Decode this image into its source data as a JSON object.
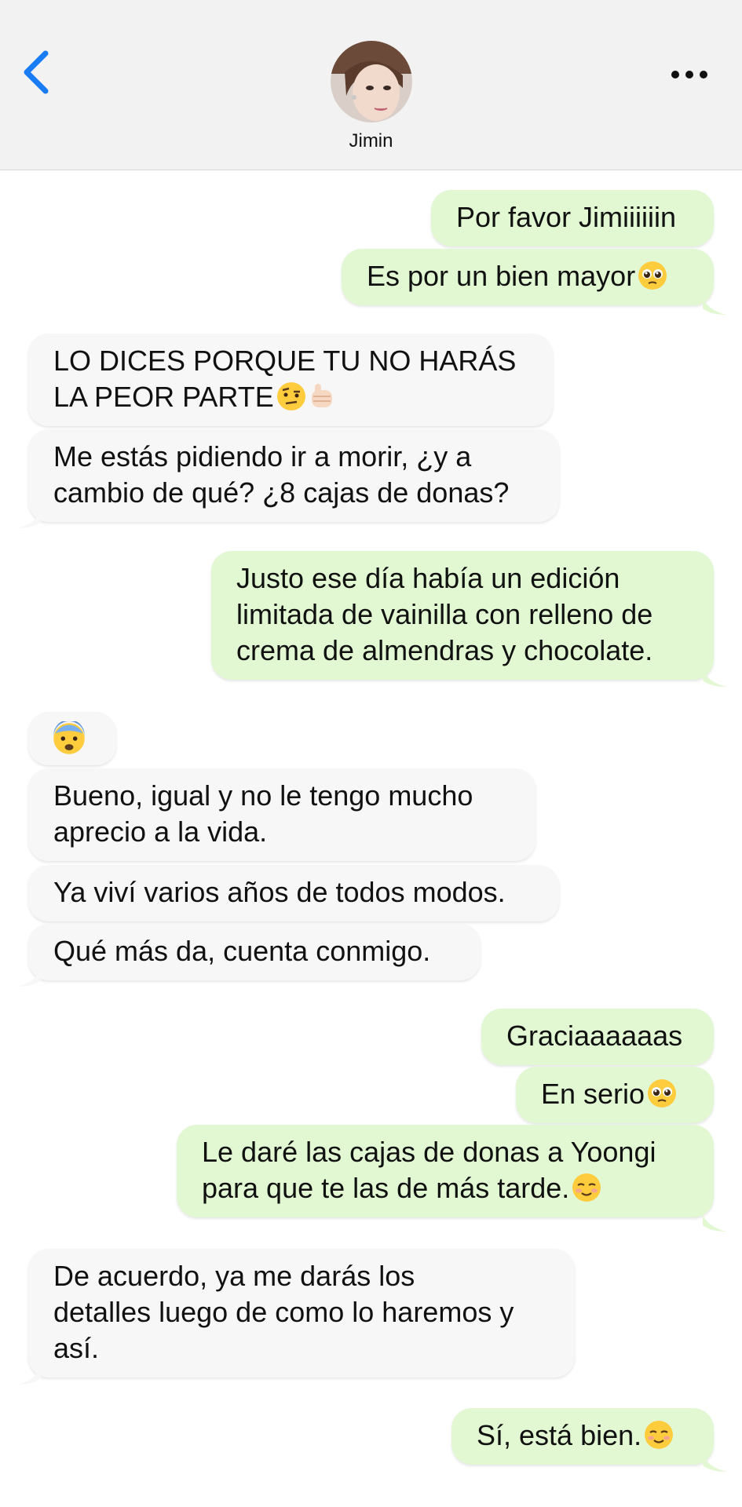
{
  "header": {
    "back_icon": "chevron-left-icon",
    "contact_name": "Jimin",
    "more_icon": "ellipsis-icon"
  },
  "colors": {
    "accent": "#1a7cf5",
    "outgoing_bubble": "#e2f8d3",
    "incoming_bubble": "#f7f7f7",
    "header_bg": "#f2f2f2"
  },
  "messages": [
    {
      "dir": "out",
      "lines": [
        "Por favor Jimiiiiiin"
      ]
    },
    {
      "dir": "out",
      "lines": [
        "Es por un bien mayor"
      ],
      "emoji": "pleading-face-emoji"
    },
    {
      "dir": "in",
      "lines": [
        "LO DICES PORQUE TU NO HARÁS",
        "LA PEOR PARTE"
      ],
      "emoji": "raised-eyebrow-face-emoji, pointing-fist-emoji"
    },
    {
      "dir": "in",
      "lines": [
        "Me estás pidiendo ir a morir, ¿y a",
        "cambio de qué? ¿8 cajas de donas?"
      ]
    },
    {
      "dir": "out",
      "lines": [
        "Justo ese día había un edición",
        "limitada de vainilla con relleno de",
        "crema de almendras y chocolate."
      ]
    },
    {
      "dir": "in",
      "lines": [
        ""
      ],
      "emoji": "fearful-face-emoji"
    },
    {
      "dir": "in",
      "lines": [
        "Bueno, igual y no le tengo mucho",
        "aprecio a la vida."
      ]
    },
    {
      "dir": "in",
      "lines": [
        "Ya viví varios años de todos modos."
      ]
    },
    {
      "dir": "in",
      "lines": [
        "Qué más da, cuenta conmigo."
      ]
    },
    {
      "dir": "out",
      "lines": [
        "Graciaaaaaas"
      ]
    },
    {
      "dir": "out",
      "lines": [
        "En serio"
      ],
      "emoji": "pleading-face-emoji"
    },
    {
      "dir": "out",
      "lines": [
        "Le daré las cajas de donas a Yoongi",
        "para que te las de más tarde."
      ],
      "emoji": "smiling-face-emoji"
    },
    {
      "dir": "in",
      "lines": [
        "De acuerdo, ya me darás los",
        "detalles luego de como lo haremos y",
        "así."
      ]
    },
    {
      "dir": "out",
      "lines": [
        "Sí, está bien."
      ],
      "emoji": "smiling-face-emoji"
    }
  ]
}
